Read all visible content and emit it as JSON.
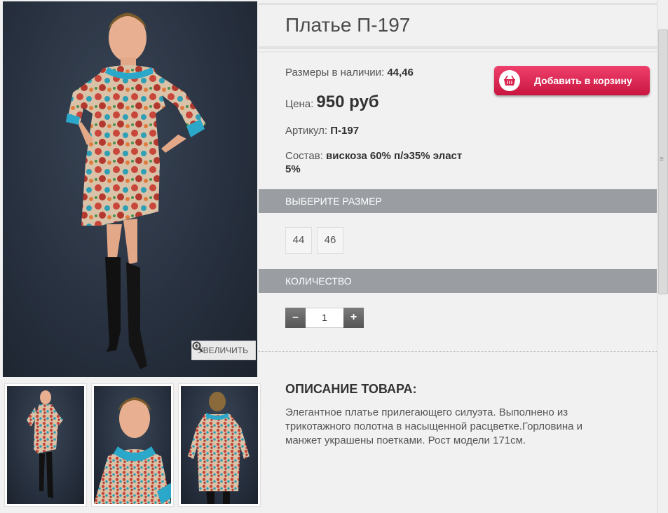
{
  "product": {
    "title": "Платье П-197",
    "sizes_label": "Размеры в наличии:",
    "sizes_value": "44,46",
    "price_label": "Цена:",
    "price_value": "950 руб",
    "sku_label": "Артикул:",
    "sku_value": "П-197",
    "composition_label": "Состав:",
    "composition_value_line1": "вискоза 60% п/э35% эласт",
    "composition_value_line2": "5%"
  },
  "cart_button": {
    "label": "Добавить в корзину",
    "icon": "basket-icon",
    "color": "#e0214f"
  },
  "gallery": {
    "zoom_label": "УВЕЛИЧИТЬ",
    "zoom_icon": "magnifier-plus-icon",
    "thumbnails": [
      "full-length front",
      "close-up portrait",
      "back view"
    ]
  },
  "size_section": {
    "header": "ВЫБЕРИТЕ РАЗМЕР",
    "options": [
      "44",
      "46"
    ]
  },
  "quantity_section": {
    "header": "КОЛИЧЕСТВО",
    "minus": "–",
    "plus": "+",
    "value": "1"
  },
  "description": {
    "heading": "ОПИСАНИЕ ТОВАРА:",
    "line1": "Элегантное платье прилегающего силуэта. Выполнено из",
    "line2": "трикотажного полотна в насыщенной расцветке.Горловина и",
    "line3": "манжет украшены поетками. Рост модели 171см."
  },
  "colors": {
    "section_bar": "#9a9ea3",
    "background": "#f1f1f1",
    "accent_collar": "#2aa7c9"
  }
}
